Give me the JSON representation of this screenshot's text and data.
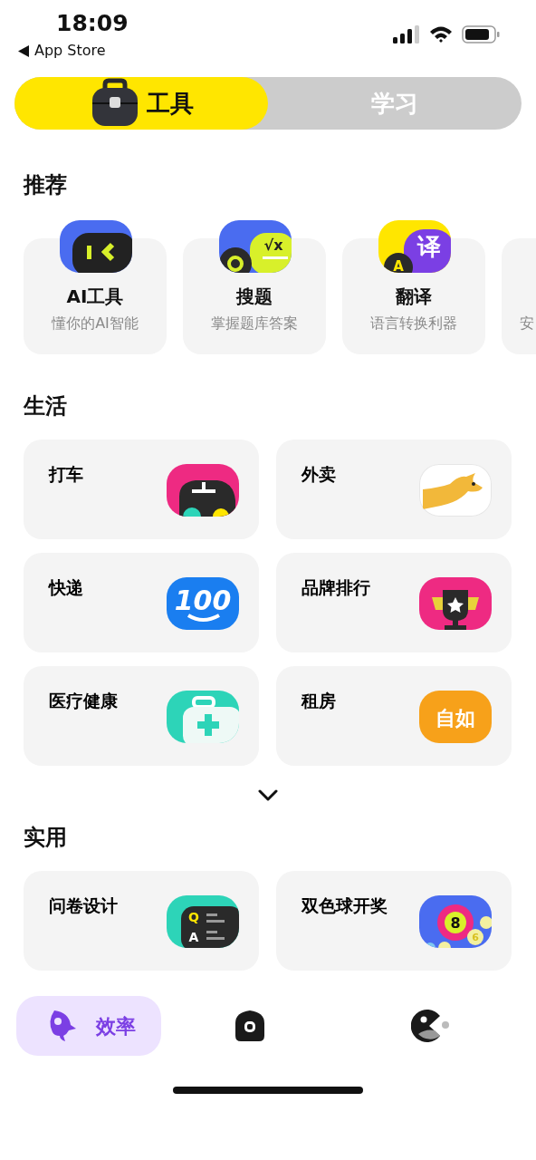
{
  "status_bar": {
    "time": "18:09",
    "back_label": "App Store"
  },
  "mode_tabs": [
    {
      "label": "工具",
      "selected": true
    },
    {
      "label": "学习",
      "selected": false
    }
  ],
  "sections": [
    {
      "title": "推荐",
      "kind": "carousel",
      "items": [
        {
          "title": "AI工具",
          "subtitle": "懂你的AI智能",
          "icon": {
            "kind": "ai"
          }
        },
        {
          "title": "搜题",
          "subtitle": "掌握题库答案",
          "icon": {
            "kind": "search",
            "glyphs": [
              "√x"
            ]
          }
        },
        {
          "title": "翻译",
          "subtitle": "语言转换利器",
          "icon": {
            "kind": "translate",
            "glyphs": [
              "译",
              "A"
            ]
          }
        },
        {
          "subtitle": "安"
        }
      ]
    },
    {
      "title": "生活",
      "kind": "grid",
      "expanded": false,
      "items": [
        {
          "title": "打车",
          "icon": {
            "kind": "car"
          }
        },
        {
          "title": "外卖",
          "icon": {
            "kind": "kangaroo"
          }
        },
        {
          "title": "快递",
          "icon": {
            "kind": "express",
            "glyphs": [
              "100"
            ]
          }
        },
        {
          "title": "品牌排行",
          "icon": {
            "kind": "trophy"
          }
        },
        {
          "title": "医疗健康",
          "icon": {
            "kind": "medical"
          }
        },
        {
          "title": "租房",
          "icon": {
            "kind": "rent",
            "glyphs": [
              "自如"
            ]
          }
        }
      ]
    },
    {
      "title": "实用",
      "kind": "grid",
      "items": [
        {
          "title": "问卷设计",
          "icon": {
            "kind": "qa",
            "glyphs": [
              "Q",
              "A"
            ]
          }
        },
        {
          "title": "双色球开奖",
          "icon": {
            "kind": "lottery",
            "glyphs": [
              "8",
              "6"
            ]
          }
        }
      ]
    }
  ],
  "bottom_nav": [
    {
      "label": "效率",
      "selected": true
    },
    {
      "selected": false
    },
    {
      "selected": false
    }
  ]
}
